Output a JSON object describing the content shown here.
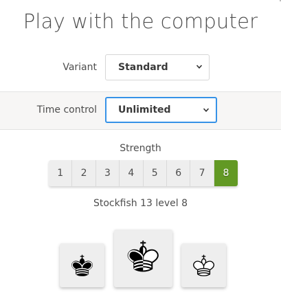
{
  "page": {
    "title": "Play with the computer"
  },
  "variant": {
    "label": "Variant",
    "selected": "Standard"
  },
  "time_control": {
    "label": "Time control",
    "selected": "Unlimited"
  },
  "strength": {
    "label": "Strength",
    "levels": [
      "1",
      "2",
      "3",
      "4",
      "5",
      "6",
      "7",
      "8"
    ],
    "selected": "8"
  },
  "engine_info": "Stockfish 13 level 8",
  "colors": {
    "accent_green": "#629924",
    "focus_blue": "#3692e7",
    "options": [
      {
        "name": "black",
        "icon": "black-king-icon"
      },
      {
        "name": "random",
        "icon": "split-king-icon"
      },
      {
        "name": "white",
        "icon": "white-king-icon"
      }
    ]
  }
}
